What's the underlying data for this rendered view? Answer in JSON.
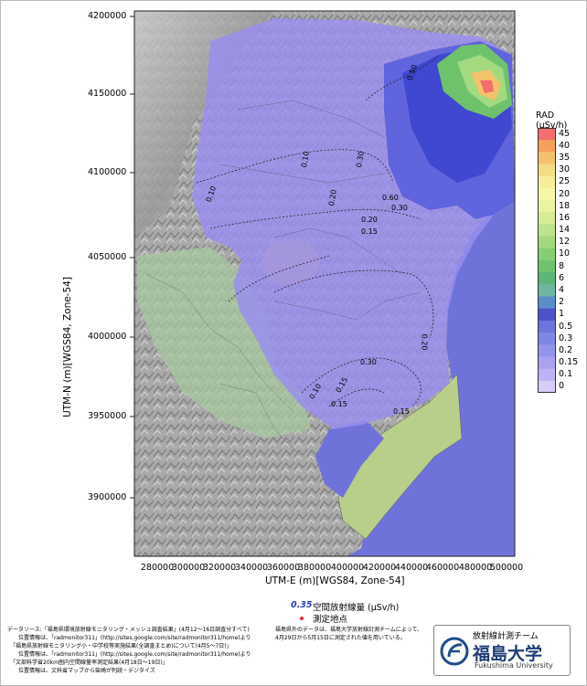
{
  "axes": {
    "xlabel": "UTM-E (m)[WGS84, Zone-54]",
    "ylabel": "UTM-N (m)[WGS84, Zone-54]",
    "xticks": [
      "280000",
      "300000",
      "320000",
      "340000",
      "360000",
      "380000",
      "400000",
      "420000",
      "440000",
      "460000",
      "480000",
      "500000"
    ],
    "yticks": [
      "4200000",
      "4150000",
      "4100000",
      "4050000",
      "4000000",
      "3950000",
      "3900000"
    ]
  },
  "legend": {
    "title": "RAD (μSv/h)",
    "levels": [
      "45",
      "40",
      "35",
      "30",
      "25",
      "20",
      "18",
      "16",
      "14",
      "12",
      "10",
      "8",
      "6",
      "4",
      "2",
      "1",
      "0.5",
      "0.3",
      "0.2",
      "0.15",
      "0.1",
      "0"
    ],
    "colors": [
      "#f26d6d",
      "#f5a05a",
      "#f3c36c",
      "#f3dc86",
      "#f6ee98",
      "#f8f6a8",
      "#e9f3a0",
      "#d6ec96",
      "#bde38b",
      "#a3d97f",
      "#86ce74",
      "#6ec26c",
      "#5db478",
      "#6fb5a2",
      "#5b8dc9",
      "#4d52c9",
      "#6c74dd",
      "#7f86e6",
      "#9494ec",
      "#a8a2f0",
      "#bdb2f4",
      "#d7ccf8"
    ]
  },
  "contour_labels": [
    "0.50",
    "0.10",
    "0.30",
    "0.10",
    "0.20",
    "0.60",
    "0.30",
    "0.20",
    "0.15",
    "0.20",
    "0.30",
    "0.15",
    "0.10",
    "0.15",
    "0.15"
  ],
  "symbols": {
    "contour_value": "0.35",
    "contour_text": "空間放射線量 (μSv/h)",
    "point_text": "測定地点"
  },
  "notes": {
    "left": "データソース:「福島県環境放射線モニタリング・メッシュ調査結果」(4月12〜16日調査分すべて)\n　　位置情報は、「radmonitor311」(http://sites.google.com/site/radmonitor311/home)より\n　「福島県放射線モニタリング小・中学校等実施結果(全調査まとめ)について(4月5〜7日)」\n　　位置情報は、「radmonitor311」(http://sites.google.com/site/radmonitor311/home)より\n　「文部科学省20km圏内空間線量率測定結果(4月18日〜19日)」\n　　位置情報は、文科省マップから柴崎が判読・デジタイズ",
    "right": "福島県外のデータは、福島大学放射線計測チームによって、\n4月29日から5月15日に測定された値を用いている。"
  },
  "logo": {
    "team": "放射線計測チーム",
    "university": "福島大学",
    "english": "Fukushima University"
  }
}
